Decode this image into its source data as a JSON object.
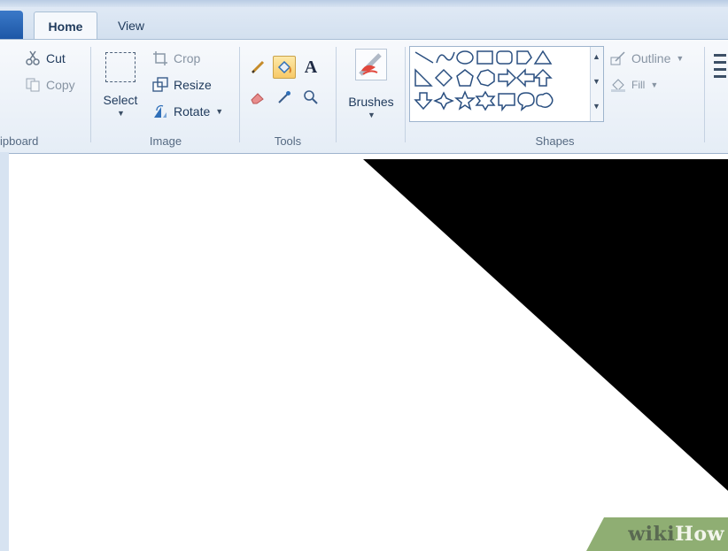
{
  "tabs": {
    "home": "Home",
    "view": "View"
  },
  "clipboard": {
    "cut": "Cut",
    "copy": "Copy",
    "label": "ipboard"
  },
  "image": {
    "select": "Select",
    "crop": "Crop",
    "resize": "Resize",
    "rotate": "Rotate",
    "label": "Image"
  },
  "tools": {
    "label": "Tools",
    "text_tool": "A"
  },
  "brushes": {
    "label": "Brushes"
  },
  "shapes": {
    "outline": "Outline",
    "fill": "Fill",
    "label": "Shapes"
  },
  "watermark": {
    "wiki": "wiki",
    "how": "How"
  },
  "colors": {
    "ribbon_text": "#1e395b",
    "accent": "#3b79c8",
    "canvas_fill": "#000000",
    "watermark_bg": "#8fae73"
  }
}
